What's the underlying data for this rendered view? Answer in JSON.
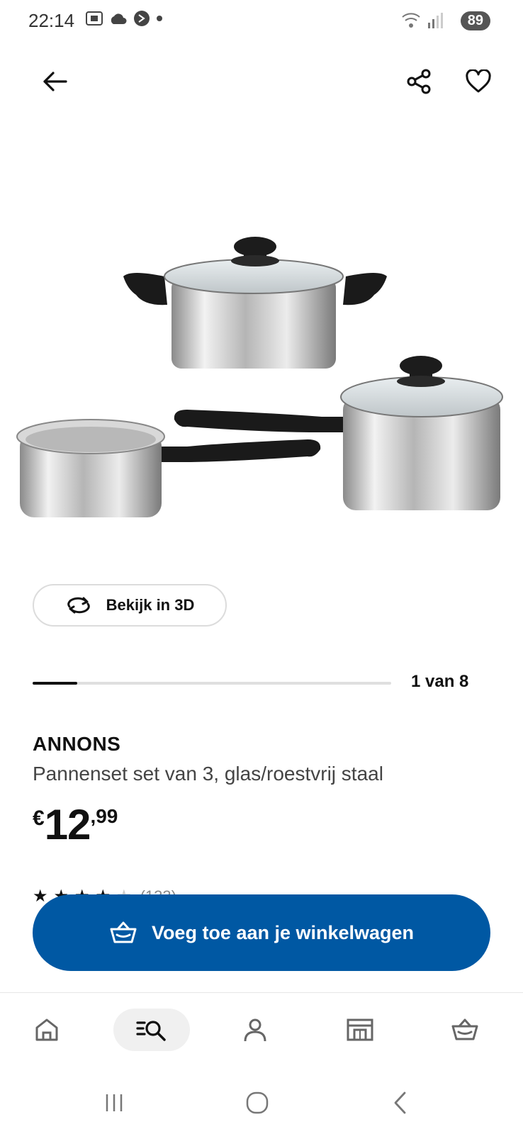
{
  "status_bar": {
    "time": "22:14",
    "battery": "89"
  },
  "header": {},
  "product": {
    "image_alt": "",
    "view_3d_label": "Bekijk in 3D",
    "carousel": {
      "current": 1,
      "total": 8,
      "label": "1 van 8",
      "progress_fraction": 0.125
    },
    "brand": "ANNONS",
    "description": "Pannenset set van 3, glas/roestvrij staal",
    "price": {
      "currency": "€",
      "integer": "12",
      "decimal": ",99"
    },
    "rating": {
      "stars": 4,
      "count_label": "(133)"
    }
  },
  "actions": {
    "add_to_cart_label": "Voeg toe aan je winkelwagen"
  },
  "colors": {
    "primary": "#0058a3",
    "text": "#111111",
    "muted": "#444444",
    "track": "#dfdfdf"
  },
  "bottom_nav": {
    "items": [
      {
        "icon": "home-icon"
      },
      {
        "icon": "search-icon"
      },
      {
        "icon": "profile-icon"
      },
      {
        "icon": "store-icon"
      },
      {
        "icon": "cart-icon"
      }
    ]
  }
}
